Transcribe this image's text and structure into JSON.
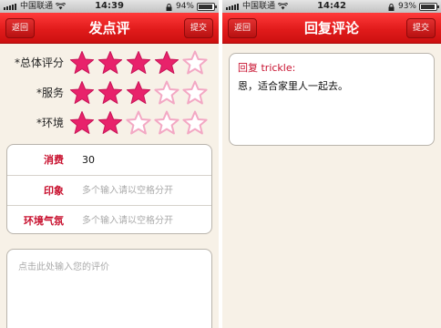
{
  "left_screen": {
    "status": {
      "carrier": "中国联通",
      "time": "14:39",
      "battery": "94%"
    },
    "nav": {
      "back": "返回",
      "title": "发点评",
      "submit": "提交"
    },
    "ratings": [
      {
        "label": "*总体评分",
        "filled": 4,
        "total": 5
      },
      {
        "label": "*服务",
        "filled": 3,
        "total": 5
      },
      {
        "label": "*环境",
        "filled": 2,
        "total": 5
      }
    ],
    "form": [
      {
        "label": "消费",
        "value": "30",
        "placeholder": ""
      },
      {
        "label": "印象",
        "value": "",
        "placeholder": "多个输入请以空格分开"
      },
      {
        "label": "环境气氛",
        "value": "",
        "placeholder": "多个输入请以空格分开"
      }
    ],
    "comment_placeholder": "点击此处输入您的评价"
  },
  "right_screen": {
    "status": {
      "carrier": "中国联通",
      "time": "14:42",
      "battery": "93%"
    },
    "nav": {
      "back": "返回",
      "title": "回复评论",
      "submit": "提交"
    },
    "reply": {
      "prefix": "回复 trickle:",
      "text": "恩，适合家里人一起去。"
    }
  },
  "colors": {
    "accent": "#c8102e",
    "star_fill": "#e8226b",
    "star_empty": "#f3a8c4",
    "nav_red": "#e11b1b"
  },
  "icons": [
    "signal-icon",
    "wifi-icon",
    "lock-icon",
    "battery-icon",
    "star-icon"
  ]
}
